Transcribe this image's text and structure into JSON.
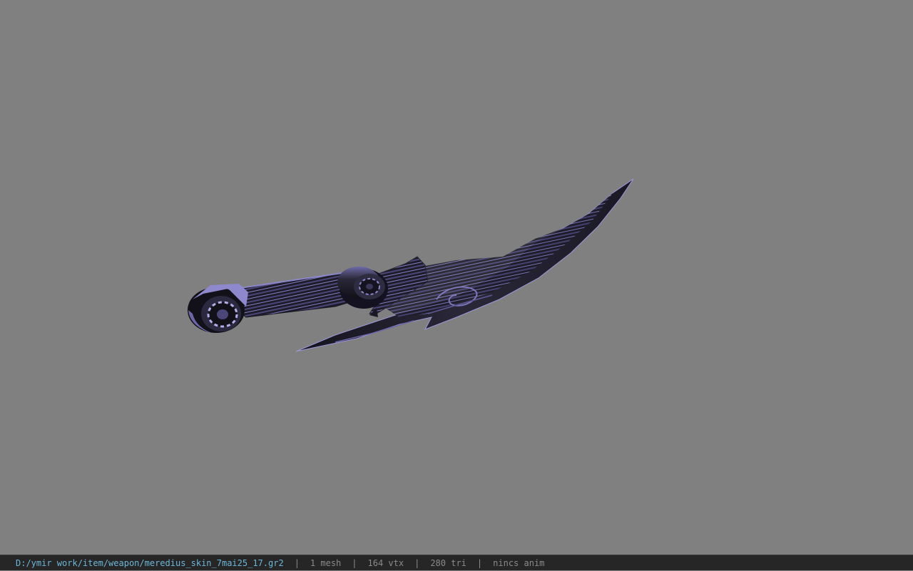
{
  "viewport": {
    "background_color": "#808080",
    "model": {
      "subject": "curved dagger weapon model",
      "colors": {
        "dark": "#1c1a26",
        "mid": "#3c3a5a",
        "highlight": "#8a86c8"
      }
    }
  },
  "status_bar": {
    "file_path": "D:/ymir work/item/weapon/meredius_skin_7mai25_17.gr2",
    "separator": "|",
    "mesh_count": "1 mesh",
    "vertex_count": "164 vtx",
    "triangle_count": "280 tri",
    "animation": "nincs anim",
    "path_color": "#6fb6d9",
    "text_color": "#8a8a8a"
  }
}
